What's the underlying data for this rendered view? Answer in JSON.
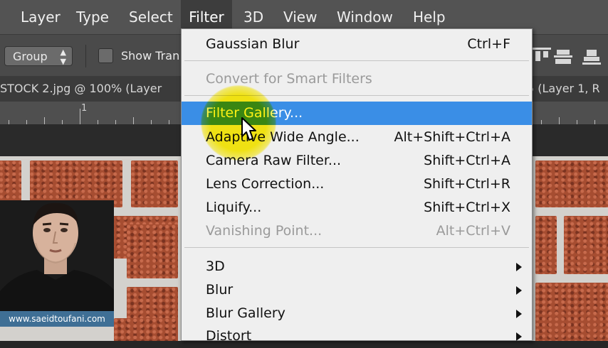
{
  "menubar": {
    "items": [
      {
        "label": "Layer"
      },
      {
        "label": "Type"
      },
      {
        "label": "Select"
      },
      {
        "label": "Filter",
        "active": true
      },
      {
        "label": "3D"
      },
      {
        "label": "View"
      },
      {
        "label": "Window"
      },
      {
        "label": "Help"
      }
    ]
  },
  "options_bar": {
    "group_select_value": "Group",
    "show_transform_label": "Show Tran"
  },
  "document": {
    "tab_title": "STOCK 2.jpg @ 100% (Layer",
    "tab_title_right": "5 (Layer 1, R",
    "ruler_mark": "1"
  },
  "watermark": {
    "url": "www.saeidtoufani.com"
  },
  "filter_menu": {
    "items": [
      {
        "label": "Gaussian Blur",
        "shortcut": "Ctrl+F"
      },
      {
        "separator": true
      },
      {
        "label": "Convert for Smart Filters",
        "disabled": true
      },
      {
        "separator": true
      },
      {
        "label": "Filter Gallery...",
        "highlighted": true
      },
      {
        "label": "Adaptive Wide Angle...",
        "shortcut": "Alt+Shift+Ctrl+A"
      },
      {
        "label": "Camera Raw Filter...",
        "shortcut": "Shift+Ctrl+A"
      },
      {
        "label": "Lens Correction...",
        "shortcut": "Shift+Ctrl+R"
      },
      {
        "label": "Liquify...",
        "shortcut": "Shift+Ctrl+X"
      },
      {
        "label": "Vanishing Point...",
        "shortcut": "Alt+Ctrl+V",
        "disabled": true
      },
      {
        "separator": true
      },
      {
        "label": "3D",
        "submenu": true
      },
      {
        "label": "Blur",
        "submenu": true
      },
      {
        "label": "Blur Gallery",
        "submenu": true
      },
      {
        "label": "Distort",
        "submenu": true
      }
    ]
  },
  "colors": {
    "highlight": "#3a8ee6",
    "menu_bg": "#efefef",
    "menubar_bg": "#535353",
    "spotlight": "#fff000"
  },
  "icons": [
    "chevron-updown-icon",
    "checkbox-icon",
    "align-icon",
    "submenu-arrow-icon",
    "mouse-cursor-icon"
  ]
}
